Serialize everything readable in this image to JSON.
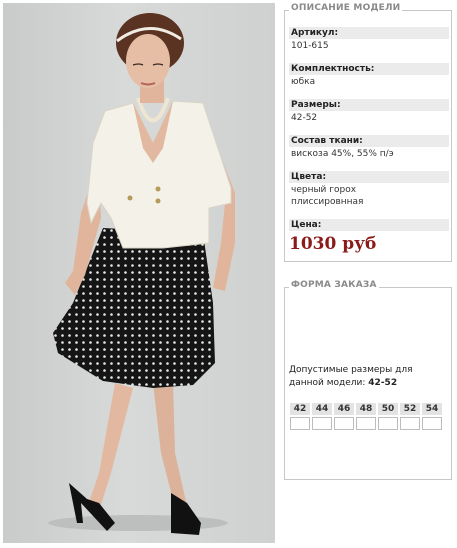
{
  "description": {
    "title": "ОПИСАНИЕ МОДЕЛИ",
    "article_label": "Артикул:",
    "article_value": "101-615",
    "set_label": "Комплектность:",
    "set_value": "юбка",
    "sizes_label": "Размеры:",
    "sizes_value": "42-52",
    "fabric_label": "Состав ткани:",
    "fabric_value": "вискоза 45%, 55% п/э",
    "colors_label": "Цвета:",
    "colors_line1": "черный горох",
    "colors_line2": "плиссировнная",
    "price_label": "Цена:",
    "price_value": "1030 руб"
  },
  "order": {
    "title": "ФОРМА ЗАКАЗА",
    "note": "Допустимые размеры для данной модели:",
    "note_sizes": "42-52",
    "sizes": [
      "42",
      "44",
      "46",
      "48",
      "50",
      "52",
      "54"
    ]
  },
  "colors": {
    "price": "#8b1a1a",
    "label_bg": "#ebebeb",
    "border": "#c8c8c8"
  }
}
